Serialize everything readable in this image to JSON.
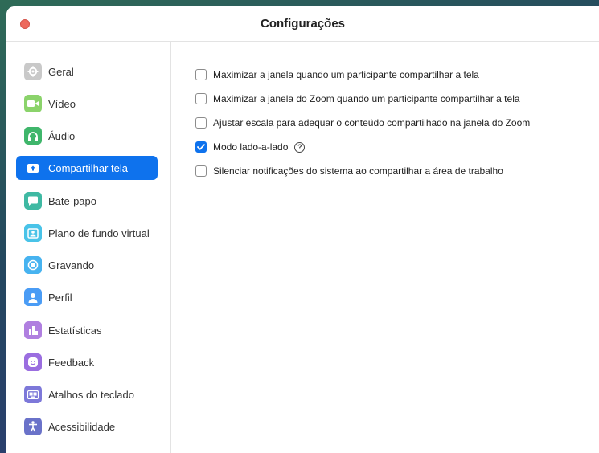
{
  "window": {
    "title": "Configurações"
  },
  "sidebar": {
    "items": [
      {
        "label": "Geral",
        "icon": "gear-icon",
        "color": "#c7c7c7",
        "active": false
      },
      {
        "label": "Vídeo",
        "icon": "video-camera-icon",
        "color": "#8bd36b",
        "active": false
      },
      {
        "label": "Áudio",
        "icon": "headphones-icon",
        "color": "#3fb66b",
        "active": false
      },
      {
        "label": "Compartilhar tela",
        "icon": "share-screen-icon",
        "color": "#0e72ed",
        "active": true
      },
      {
        "label": "Bate-papo",
        "icon": "chat-bubble-icon",
        "color": "#3fb9a3",
        "active": false
      },
      {
        "label": "Plano de fundo virtual",
        "icon": "virtual-background-icon",
        "color": "#49c3e8",
        "active": false
      },
      {
        "label": "Gravando",
        "icon": "record-icon",
        "color": "#47b3f0",
        "active": false
      },
      {
        "label": "Perfil",
        "icon": "person-icon",
        "color": "#4a9cf5",
        "active": false
      },
      {
        "label": "Estatísticas",
        "icon": "bar-chart-icon",
        "color": "#b07fe0",
        "active": false
      },
      {
        "label": "Feedback",
        "icon": "smiley-icon",
        "color": "#9b6ee0",
        "active": false
      },
      {
        "label": "Atalhos do teclado",
        "icon": "keyboard-icon",
        "color": "#7d78d9",
        "active": false
      },
      {
        "label": "Acessibilidade",
        "icon": "accessibility-icon",
        "color": "#6a72c9",
        "active": false
      }
    ]
  },
  "options": [
    {
      "label": "Maximizar a janela quando um participante compartilhar a tela",
      "checked": false,
      "help": false
    },
    {
      "label": "Maximizar a janela do Zoom quando um participante compartilhar a tela",
      "checked": false,
      "help": false
    },
    {
      "label": "Ajustar escala para adequar o conteúdo compartilhado na janela do Zoom",
      "checked": false,
      "help": false
    },
    {
      "label": "Modo lado-a-lado",
      "checked": true,
      "help": true
    },
    {
      "label": "Silenciar notificações do sistema ao compartilhar a área de trabalho",
      "checked": false,
      "help": false
    }
  ],
  "colors": {
    "accent": "#0e72ed",
    "close_button": "#ed6a5e"
  }
}
